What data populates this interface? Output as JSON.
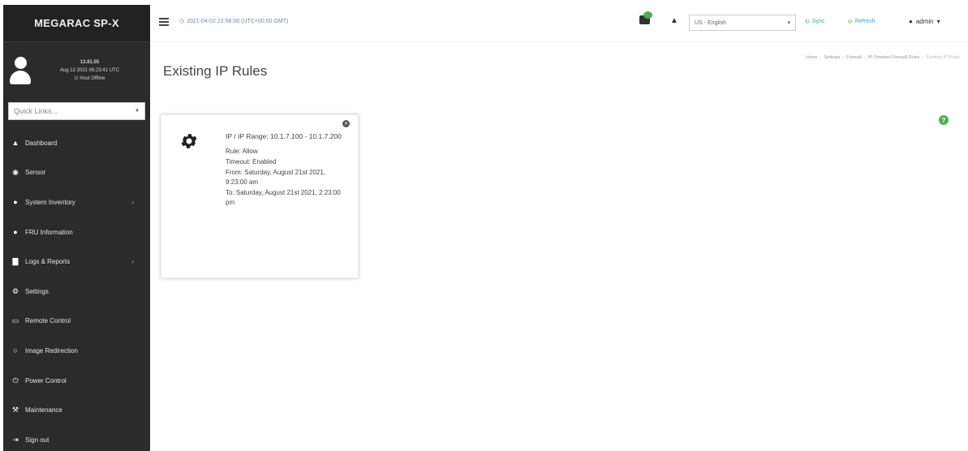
{
  "sidebar": {
    "brand": "MEGARAC SP-X",
    "user": {
      "version": "13.81.55",
      "datetime": "Aug 12 2021 06:23:41 UTC",
      "host_status": "Host Offline"
    },
    "quick_links_placeholder": "Quick Links...",
    "items": [
      {
        "label": "Dashboard",
        "icon": "home-icon",
        "glyph": "▲",
        "chevron": false
      },
      {
        "label": "Sensor",
        "icon": "sensor-icon",
        "glyph": "◉",
        "chevron": false
      },
      {
        "label": "System Inventory",
        "icon": "info-icon",
        "glyph": "●",
        "chevron": true
      },
      {
        "label": "FRU Information",
        "icon": "info-icon",
        "glyph": "●",
        "chevron": false
      },
      {
        "label": "Logs & Reports",
        "icon": "bar-chart-icon",
        "glyph": "▇",
        "chevron": true
      },
      {
        "label": "Settings",
        "icon": "gear-icon",
        "glyph": "⚙",
        "chevron": false
      },
      {
        "label": "Remote Control",
        "icon": "monitor-icon",
        "glyph": "▭",
        "chevron": false
      },
      {
        "label": "Image Redirection",
        "icon": "disc-icon",
        "glyph": "○",
        "chevron": false
      },
      {
        "label": "Power Control",
        "icon": "power-icon",
        "glyph": "⏻",
        "chevron": false
      },
      {
        "label": "Maintenance",
        "icon": "wrench-icon",
        "glyph": "⚒",
        "chevron": false
      },
      {
        "label": "Sign out",
        "icon": "sign-out-icon",
        "glyph": "⇥",
        "chevron": false
      }
    ]
  },
  "header": {
    "datetime": "2021-04-02 22:58:00 (UTC+00:00 GMT)",
    "language": "US - English",
    "sync_label": "Sync",
    "refresh_label": "Refresh",
    "user_label": "admin"
  },
  "main": {
    "title": "Existing IP Rules",
    "breadcrumb": [
      "Home",
      "Settings",
      "Firewall",
      "IP Oriented Firewall Rules",
      "Existing IP Rules"
    ],
    "rule": {
      "range_label": "IP / IP Range: 10.1.7.100 - 10.1.7.200",
      "rule_label": "Rule: Allow",
      "timeout_label": "Timeout: Enabled",
      "from_label": "From: Saturday, August 21st 2021, 9:23:00 am",
      "to_label": "To: Saturday, August 21st 2021, 2:23:00 pm"
    }
  },
  "colors": {
    "sidebar_bg": "#2b2b2b",
    "accent_green": "#4caf50",
    "link_blue": "#3aa0c8"
  }
}
